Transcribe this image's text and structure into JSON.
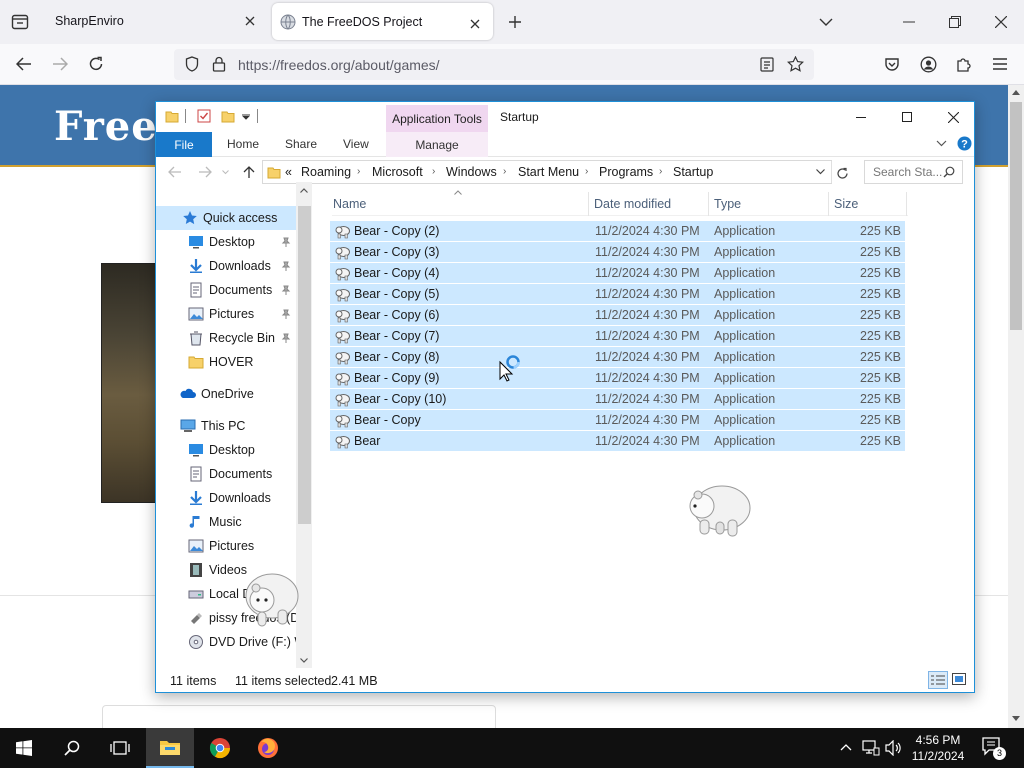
{
  "browser": {
    "tabs": [
      {
        "label": "SharpEnviro",
        "active": false
      },
      {
        "label": "The FreeDOS Project",
        "active": true
      }
    ],
    "url": "https://freedos.org/about/games/"
  },
  "webpage": {
    "banner_title": "Free"
  },
  "explorer": {
    "title": "Startup",
    "context_tab_group": "Application Tools",
    "ribbon_tabs": [
      "File",
      "Home",
      "Share",
      "View"
    ],
    "context_tab": "Manage",
    "breadcrumb": [
      "«",
      "Roaming",
      "Microsoft",
      "Windows",
      "Start Menu",
      "Programs",
      "Startup"
    ],
    "search_placeholder": "Search Sta...",
    "nav": {
      "quick_access": "Quick access",
      "quick_items": [
        "Desktop",
        "Downloads",
        "Documents",
        "Pictures",
        "Recycle Bin",
        "HOVER"
      ],
      "onedrive": "OneDrive",
      "this_pc": "This PC",
      "pc_items": [
        "Desktop",
        "Documents",
        "Downloads",
        "Music",
        "Pictures",
        "Videos",
        "Local D",
        "pissy freedos (D:",
        "DVD Drive (F:) W"
      ]
    },
    "columns": {
      "name": "Name",
      "date": "Date modified",
      "type": "Type",
      "size": "Size"
    },
    "files": [
      {
        "name": "Bear - Copy (2)",
        "date": "11/2/2024 4:30 PM",
        "type": "Application",
        "size": "225 KB"
      },
      {
        "name": "Bear - Copy (3)",
        "date": "11/2/2024 4:30 PM",
        "type": "Application",
        "size": "225 KB"
      },
      {
        "name": "Bear - Copy (4)",
        "date": "11/2/2024 4:30 PM",
        "type": "Application",
        "size": "225 KB"
      },
      {
        "name": "Bear - Copy (5)",
        "date": "11/2/2024 4:30 PM",
        "type": "Application",
        "size": "225 KB"
      },
      {
        "name": "Bear - Copy (6)",
        "date": "11/2/2024 4:30 PM",
        "type": "Application",
        "size": "225 KB"
      },
      {
        "name": "Bear - Copy (7)",
        "date": "11/2/2024 4:30 PM",
        "type": "Application",
        "size": "225 KB"
      },
      {
        "name": "Bear - Copy (8)",
        "date": "11/2/2024 4:30 PM",
        "type": "Application",
        "size": "225 KB"
      },
      {
        "name": "Bear - Copy (9)",
        "date": "11/2/2024 4:30 PM",
        "type": "Application",
        "size": "225 KB"
      },
      {
        "name": "Bear - Copy (10)",
        "date": "11/2/2024 4:30 PM",
        "type": "Application",
        "size": "225 KB"
      },
      {
        "name": "Bear - Copy",
        "date": "11/2/2024 4:30 PM",
        "type": "Application",
        "size": "225 KB"
      },
      {
        "name": "Bear",
        "date": "11/2/2024 4:30 PM",
        "type": "Application",
        "size": "225 KB"
      }
    ],
    "status": {
      "count": "11 items",
      "selected": "11 items selected",
      "size": "2.41 MB"
    }
  },
  "taskbar": {
    "time": "4:56 PM",
    "date": "11/2/2024",
    "notification_count": "3"
  },
  "colors": {
    "selection": "#cce8ff",
    "file_tab": "#1979ca",
    "banner": "#3e74ab"
  }
}
